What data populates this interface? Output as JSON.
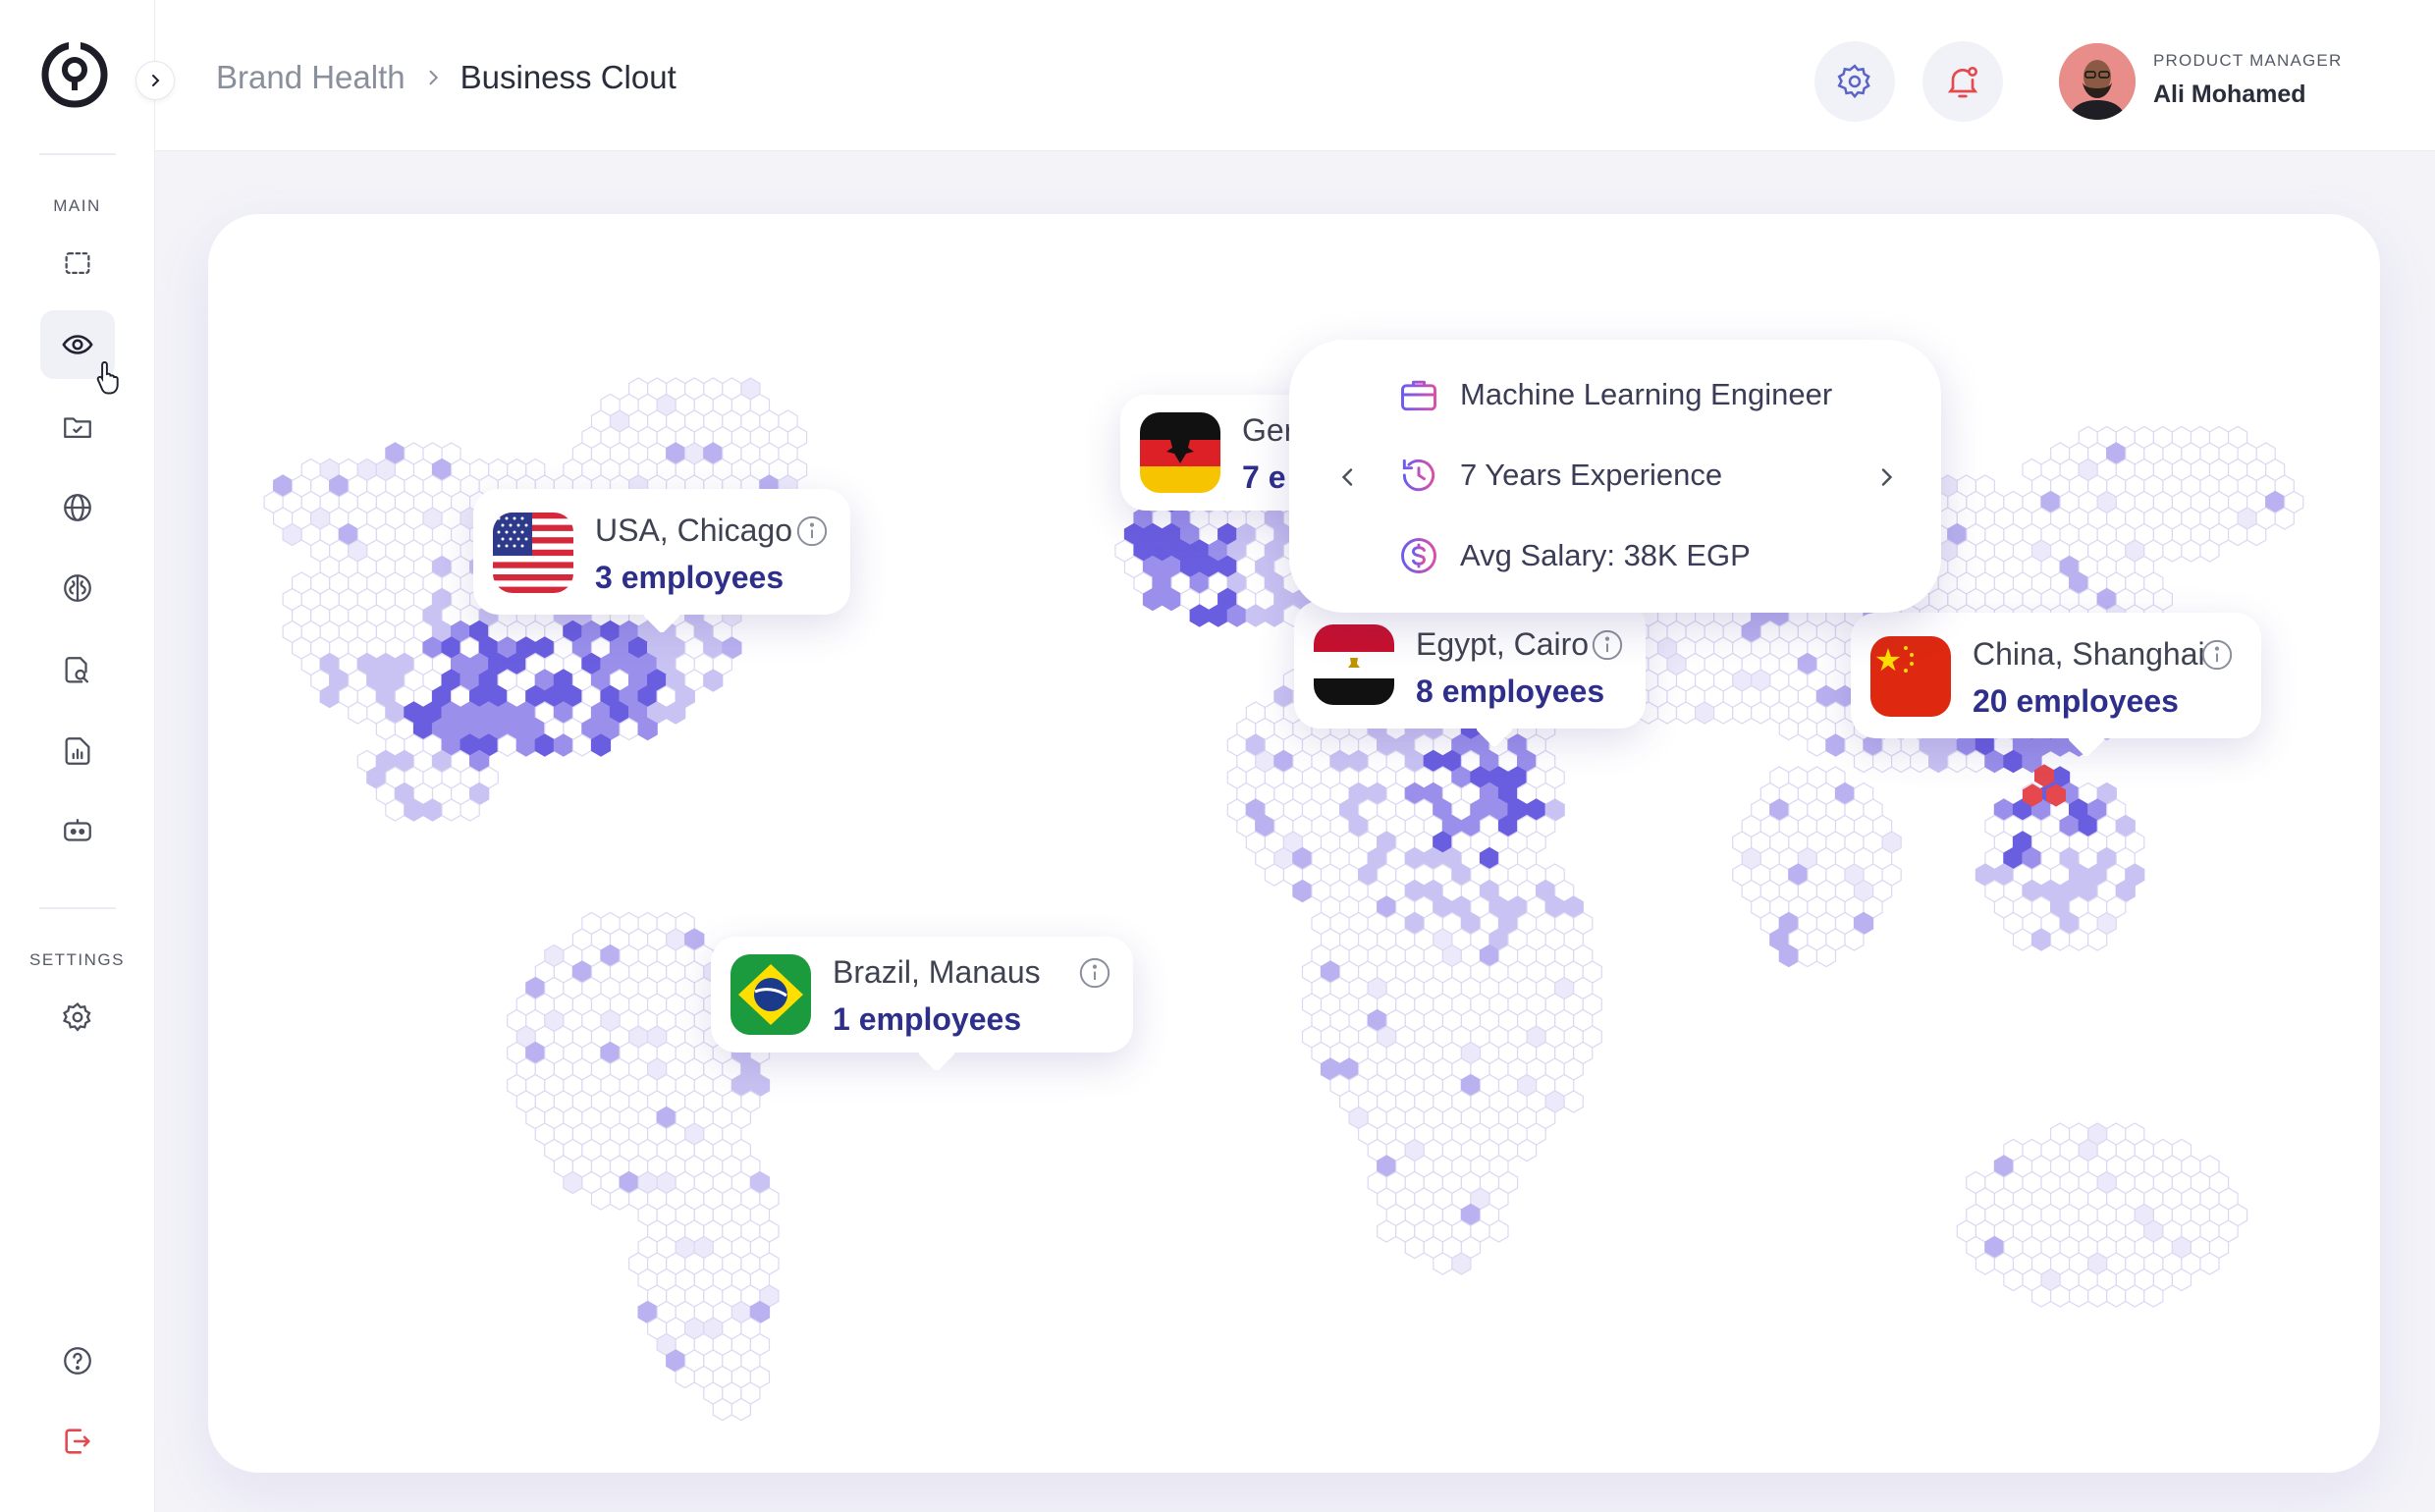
{
  "breadcrumb": {
    "parent": "Brand Health",
    "current": "Business Clout"
  },
  "sidebar": {
    "main_label": "MAIN",
    "settings_label": "SETTINGS",
    "items": [
      {
        "icon": "scan-icon"
      },
      {
        "icon": "eye-icon"
      },
      {
        "icon": "folder-check-icon"
      },
      {
        "icon": "globe-icon"
      },
      {
        "icon": "brain-icon"
      },
      {
        "icon": "document-search-icon"
      },
      {
        "icon": "report-icon"
      },
      {
        "icon": "bot-icon"
      }
    ]
  },
  "user": {
    "role": "PRODUCT MANAGER",
    "name": "Ali Mohamed"
  },
  "colors": {
    "accent": "#5b4fd9",
    "accent_light": "#c9c3f3",
    "danger": "#e5484d",
    "navy": "#2e2f8a"
  },
  "locations": [
    {
      "name": "USA, Chicago",
      "count": "3 employees",
      "flag": "us"
    },
    {
      "name": "Ger",
      "count": "7 e",
      "flag": "de"
    },
    {
      "name": "Egypt, Cairo",
      "count": "8 employees",
      "flag": "eg"
    },
    {
      "name": "China, Shanghai",
      "count": "20 employees",
      "flag": "cn"
    },
    {
      "name": "Brazil, Manaus",
      "count": "1 employees",
      "flag": "br"
    }
  ],
  "detail": {
    "title": "Machine Learning Engineer",
    "experience": "7 Years Experience",
    "salary": "Avg Salary: 38K EGP"
  }
}
